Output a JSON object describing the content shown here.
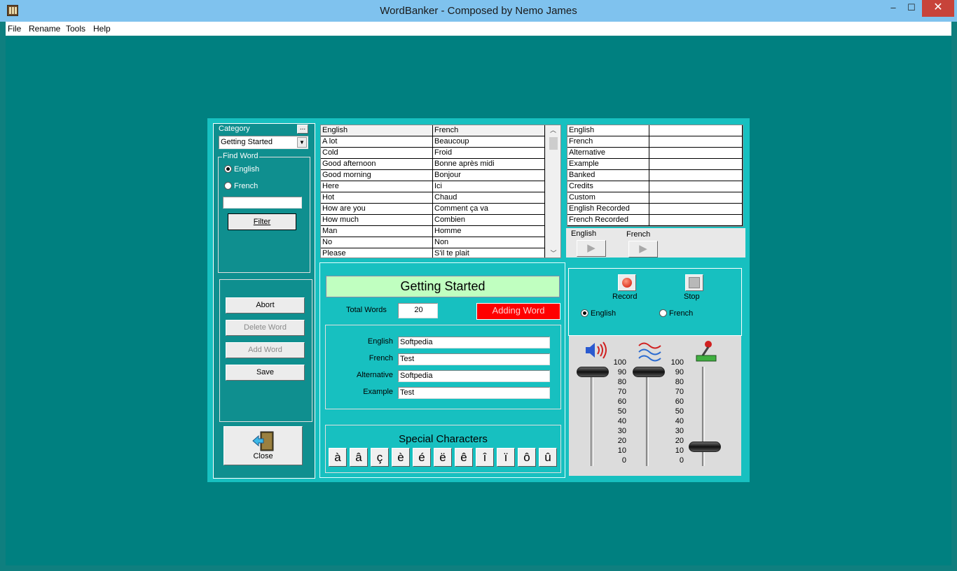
{
  "window": {
    "title": "WordBanker - Composed by Nemo James",
    "min": "–",
    "max": "☐",
    "close": "✕"
  },
  "menu": [
    "File",
    "Rename",
    "Tools",
    "Help"
  ],
  "left": {
    "category_label": "Category",
    "category_more": "...",
    "category_value": "Getting Started",
    "find_word_label": "Find Word",
    "radio_english": "English",
    "radio_french": "French",
    "search_value": "",
    "filter_button": "Filter",
    "abort_button": "Abort",
    "delete_button": "Delete Word",
    "add_button": "Add Word",
    "save_button": "Save",
    "close_button": "Close"
  },
  "word_list": {
    "headers": [
      "English",
      "French"
    ],
    "rows": [
      [
        "A lot",
        "Beaucoup"
      ],
      [
        "Cold",
        "Froid"
      ],
      [
        "Good afternoon",
        "Bonne après midi"
      ],
      [
        "Good morning",
        "Bonjour"
      ],
      [
        "Here",
        "Ici"
      ],
      [
        "Hot",
        "Chaud"
      ],
      [
        "How are you",
        "Comment ça va"
      ],
      [
        "How much",
        "Combien"
      ],
      [
        "Man",
        "Homme"
      ],
      [
        "No",
        "Non"
      ],
      [
        "Please",
        "S'il te plait"
      ]
    ]
  },
  "details": {
    "rows": [
      "English",
      "French",
      "Alternative",
      "Example",
      "Banked",
      "Credits",
      "Custom",
      "English Recorded",
      "French Recorded"
    ]
  },
  "playback": {
    "english_label": "English",
    "french_label": "French"
  },
  "editor": {
    "category_title": "Getting Started",
    "total_words_label": "Total Words",
    "total_words_value": "20",
    "status": "Adding Word",
    "fields": [
      {
        "label": "English",
        "value": "Softpedia"
      },
      {
        "label": "French",
        "value": "Test"
      },
      {
        "label": "Alternative",
        "value": "Softpedia"
      },
      {
        "label": "Example",
        "value": "Test"
      }
    ],
    "special_label": "Special Characters",
    "special_chars": [
      "à",
      "â",
      "ç",
      "è",
      "é",
      "ë",
      "ê",
      "î",
      "ï",
      "ô",
      "û"
    ]
  },
  "recorder": {
    "record_label": "Record",
    "stop_label": "Stop",
    "radio_english": "English",
    "radio_french": "French",
    "scale": [
      "100",
      "90",
      "80",
      "70",
      "60",
      "50",
      "40",
      "30",
      "20",
      "10",
      "0"
    ],
    "volume_level": 100,
    "balance_level": 100,
    "mic_level": 20
  },
  "colors": {
    "status_bg": "#ff0000",
    "title_bg": "#c0ffc0",
    "teal": "#008080",
    "panel": "#17c0c0"
  }
}
